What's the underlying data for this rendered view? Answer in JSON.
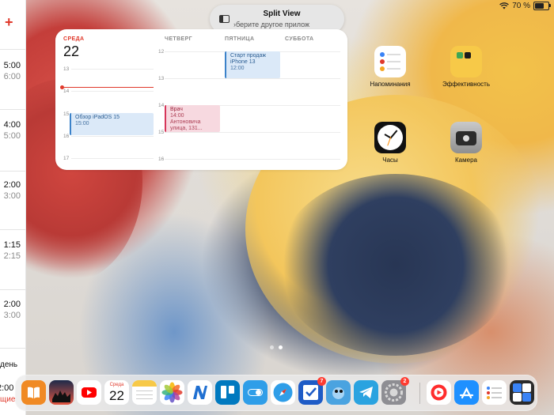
{
  "status_bar": {
    "battery_text": "70 %"
  },
  "split_view": {
    "title": "Split View",
    "hint": "›берите другое прилож"
  },
  "left_panel": {
    "add_symbol": "+",
    "times": [
      {
        "main": "5:00",
        "sub": "6:00"
      },
      {
        "main": "4:00",
        "sub": "5:00"
      },
      {
        "main": "2:00",
        "sub": "3:00"
      },
      {
        "main": "1:15",
        "sub": "2:15"
      },
      {
        "main": "2:00",
        "sub": "3:00"
      }
    ],
    "day_label": "день",
    "time_bottom": "2:00",
    "red_label": "щие"
  },
  "calendar_widget": {
    "columns": [
      "СРЕДА",
      "ЧЕТВЕРГ",
      "ПЯТНИЦА",
      "СУББОТА"
    ],
    "today_number": "22",
    "hours_col1": [
      "13",
      "14",
      "15",
      "16",
      "17"
    ],
    "hours_col2": [
      "12",
      "13",
      "14",
      "15",
      "16"
    ],
    "events": [
      {
        "title": "Обзор iPadOS 15",
        "time": "15:00",
        "color": "blue"
      },
      {
        "title": "Врач",
        "time": "14:00",
        "detail": "Антоновича улица, 131...",
        "color": "red"
      },
      {
        "title": "Старт продаж iPhone 13",
        "time": "12:00",
        "color": "blue"
      }
    ]
  },
  "home_apps": [
    {
      "label": "Напоминания",
      "icon": "reminders-icon"
    },
    {
      "label": "Эффективность",
      "icon": "productivity-folder-icon"
    },
    {
      "label": "Часы",
      "icon": "clock-icon"
    },
    {
      "label": "Камера",
      "icon": "camera-icon"
    }
  ],
  "dock": {
    "calendar_day": "Среда",
    "calendar_date": "22",
    "badges": {
      "tasks": "7",
      "settings": "2"
    },
    "apps": [
      "books-icon",
      "news-icon",
      "youtube-icon",
      "calendar-icon",
      "notes-icon",
      "photos-icon",
      "nova-icon",
      "trello-icon",
      "toggle-app-icon",
      "safari-icon",
      "tasks-icon",
      "tweetbot-icon",
      "telegram-icon",
      "settings-icon",
      "music-icon",
      "app-store-icon",
      "reminders-icon",
      "translate-icon"
    ]
  }
}
